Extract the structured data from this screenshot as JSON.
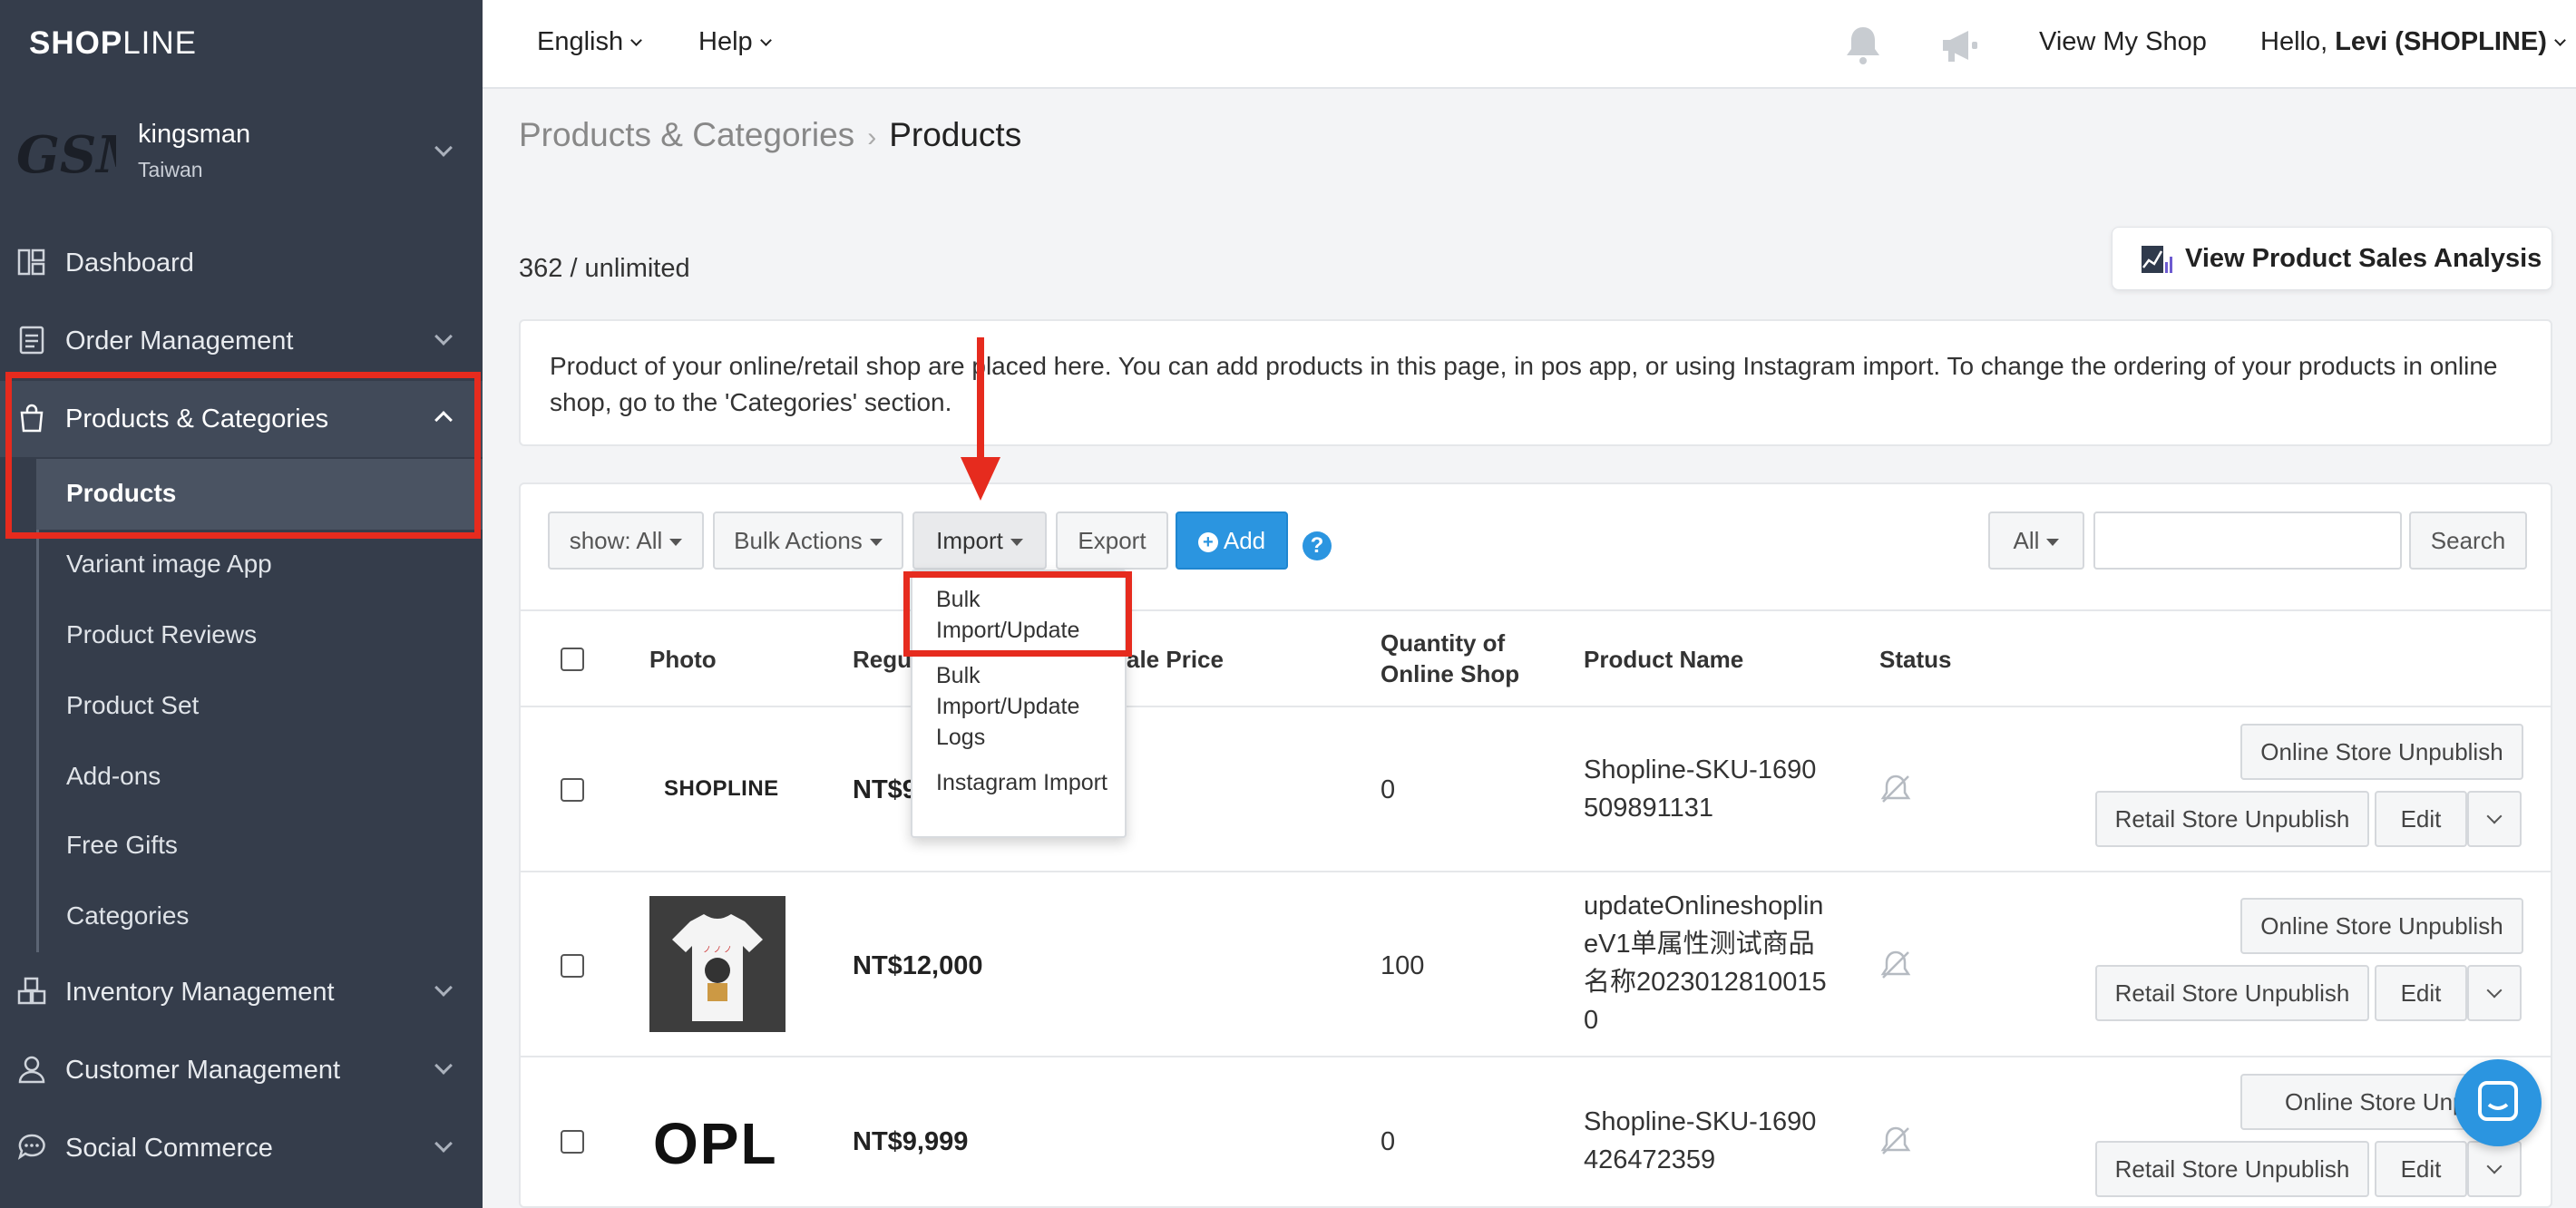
{
  "brand": {
    "logo_bold": "SHOP",
    "logo_thin": "LINE"
  },
  "store": {
    "logo_text": "GSM",
    "name": "kingsman",
    "region": "Taiwan"
  },
  "sidebar": {
    "items": [
      {
        "label": "Dashboard",
        "icon": "dashboard-icon"
      },
      {
        "label": "Order Management",
        "icon": "order-icon"
      },
      {
        "label": "Products & Categories",
        "icon": "shopping-bag-icon"
      },
      {
        "label": "Inventory Management",
        "icon": "inventory-icon"
      },
      {
        "label": "Customer Management",
        "icon": "customer-icon"
      },
      {
        "label": "Social Commerce",
        "icon": "chat-icon"
      }
    ],
    "sub_items": [
      {
        "label": "Products"
      },
      {
        "label": "Variant image App"
      },
      {
        "label": "Product Reviews"
      },
      {
        "label": "Product Set"
      },
      {
        "label": "Add-ons"
      },
      {
        "label": "Free Gifts"
      },
      {
        "label": "Categories"
      }
    ]
  },
  "topbar": {
    "language": "English",
    "help": "Help",
    "view_shop": "View My Shop",
    "hello_prefix": "Hello, ",
    "user": "Levi (SHOPLINE)"
  },
  "breadcrumb": {
    "parent": "Products & Categories",
    "current": "Products"
  },
  "count_text": "362 / unlimited",
  "analysis_button": "View Product Sales Analysis",
  "info_text": "Product of your online/retail shop are placed here. You can add products in this page, in pos app, or using Instagram import. To change the ordering of your products in online shop, go to the 'Categories' section.",
  "toolbar": {
    "show": "show: All",
    "bulk_actions": "Bulk Actions",
    "import": "Import",
    "export": "Export",
    "add": "Add",
    "filter": "All",
    "search_placeholder": "",
    "search": "Search"
  },
  "import_menu": [
    {
      "label": "Bulk Import/Update"
    },
    {
      "label": "Bulk Import/Update Logs"
    },
    {
      "label": "Instagram Import"
    }
  ],
  "table": {
    "headers": {
      "photo": "Photo",
      "regular_price": "Regu",
      "sale_price": "ale Price",
      "quantity": "Quantity of Online Shop",
      "product_name": "Product Name",
      "status": "Status"
    },
    "rows": [
      {
        "photo": "SHOPLINE",
        "price": "NT$9",
        "quantity": "0",
        "name": "Shopline-SKU-1690509891131"
      },
      {
        "photo": "",
        "price": "NT$12,000",
        "quantity": "100",
        "name": "updateOnlineshoplineV1单属性测试商品名称20230128100150"
      },
      {
        "photo": "OPL",
        "price": "NT$9,999",
        "quantity": "0",
        "name": "Shopline-SKU-1690426472359"
      }
    ],
    "actions": {
      "online_unpublish": "Online Store Unpublish",
      "online_unpublish_cut": "Online Store Unpu",
      "retail_unpublish": "Retail Store Unpublish",
      "edit": "Edit"
    }
  },
  "colors": {
    "sidebar": "#353d4b",
    "accent": "#2b95e0",
    "highlight": "#e62b1e"
  }
}
